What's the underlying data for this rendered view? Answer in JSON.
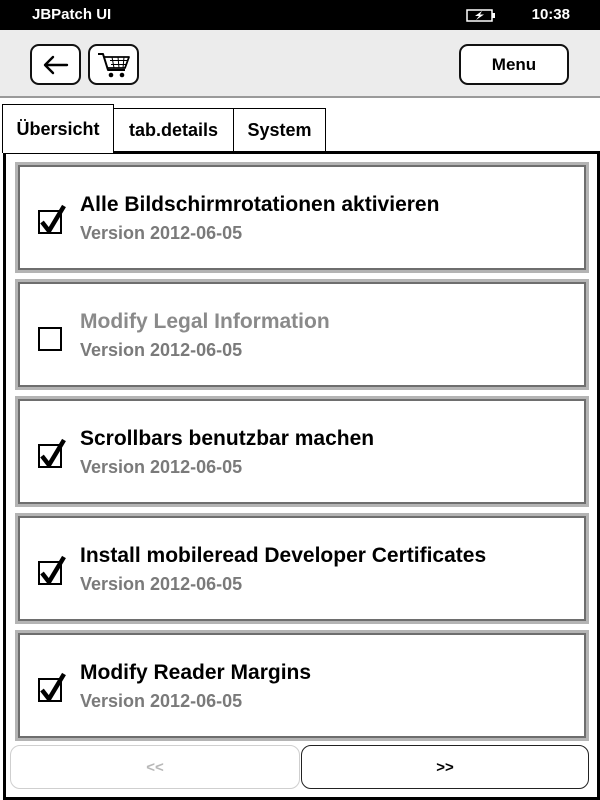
{
  "status_bar": {
    "app_title": "JBPatch UI",
    "time": "10:38",
    "battery_icon": "battery-charging-icon"
  },
  "toolbar": {
    "back_icon": "back-arrow-icon",
    "cart_icon": "cart-icon",
    "menu_label": "Menu"
  },
  "tabs": [
    {
      "label": "Übersicht",
      "active": true
    },
    {
      "label": "tab.details",
      "active": false
    },
    {
      "label": "System",
      "active": false
    }
  ],
  "items": [
    {
      "title": "Alle Bildschirmrotationen aktivieren",
      "version": "Version 2012-06-05",
      "checked": true,
      "enabled": true
    },
    {
      "title": "Modify Legal Information",
      "version": "Version 2012-06-05",
      "checked": false,
      "enabled": false
    },
    {
      "title": "Scrollbars benutzbar machen",
      "version": "Version 2012-06-05",
      "checked": true,
      "enabled": true
    },
    {
      "title": "Install mobileread Developer Certificates",
      "version": "Version 2012-06-05",
      "checked": true,
      "enabled": true
    },
    {
      "title": "Modify Reader Margins",
      "version": "Version 2012-06-05",
      "checked": true,
      "enabled": true
    }
  ],
  "pager": {
    "prev_label": "<<",
    "next_label": ">>",
    "prev_enabled": false,
    "next_enabled": true
  }
}
